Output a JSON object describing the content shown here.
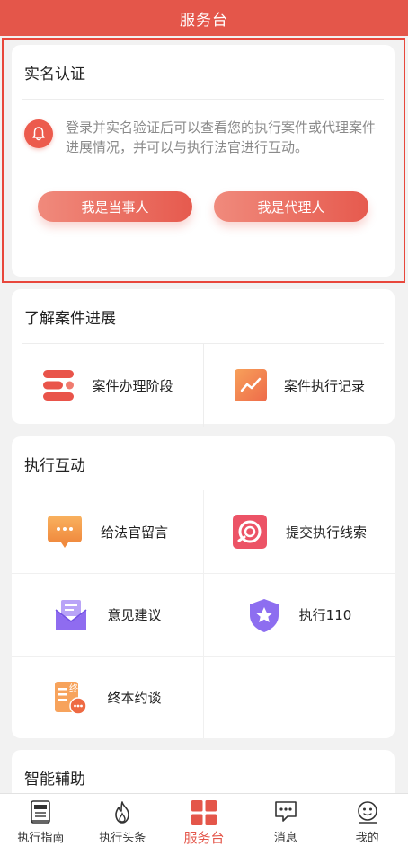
{
  "header": {
    "title": "服务台"
  },
  "verify": {
    "title": "实名认证",
    "notice": "登录并实名验证后可以查看您的执行案件或代理案件进展情况，并可以与执行法官进行互动。",
    "party_button": "我是当事人",
    "agent_button": "我是代理人"
  },
  "progress": {
    "title": "了解案件进展",
    "items": [
      {
        "label": "案件办理阶段",
        "icon": "stages-icon"
      },
      {
        "label": "案件执行记录",
        "icon": "trend-icon"
      }
    ]
  },
  "interact": {
    "title": "执行互动",
    "items": [
      {
        "label": "给法官留言",
        "icon": "message-icon"
      },
      {
        "label": "提交执行线索",
        "icon": "clue-icon"
      },
      {
        "label": "意见建议",
        "icon": "mail-icon"
      },
      {
        "label": "执行110",
        "icon": "shield-star-icon"
      },
      {
        "label": "终本约谈",
        "icon": "interview-icon"
      }
    ]
  },
  "assist": {
    "title": "智能辅助"
  },
  "bottom_nav": {
    "items": [
      {
        "label": "执行指南",
        "icon": "guide-icon"
      },
      {
        "label": "执行头条",
        "icon": "flame-icon"
      },
      {
        "label": "服务台",
        "icon": "grid-icon",
        "active": true
      },
      {
        "label": "消息",
        "icon": "chat-icon"
      },
      {
        "label": "我的",
        "icon": "face-icon"
      }
    ]
  },
  "colors": {
    "accent": "#e4564a",
    "button_gradient_start": "#f08a7c",
    "button_gradient_end": "#e65a4e"
  }
}
